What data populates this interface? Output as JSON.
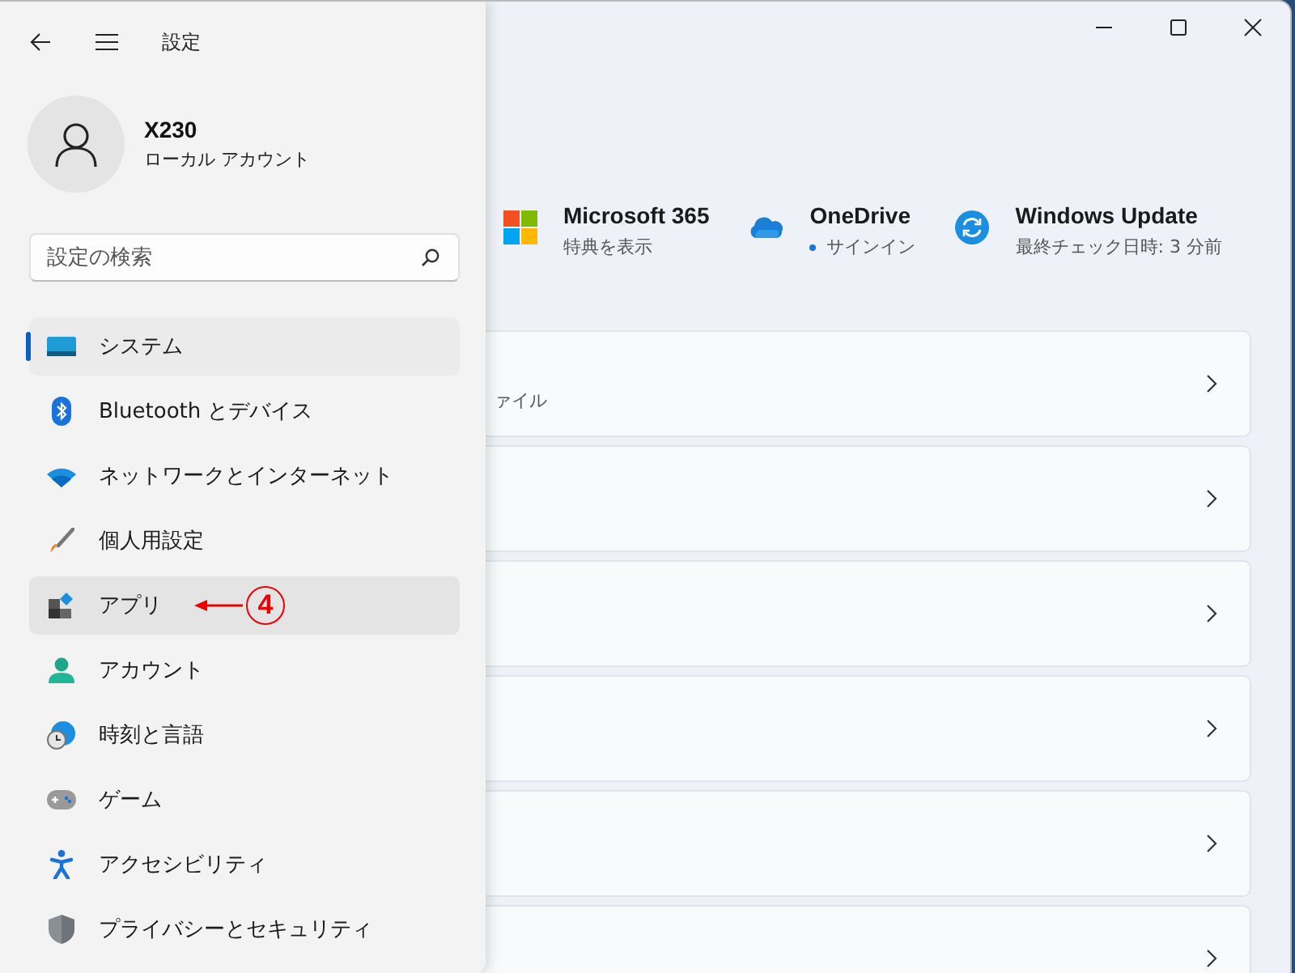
{
  "window": {
    "title": "設定",
    "controls": [
      {
        "kind": "minimize"
      },
      {
        "kind": "maximize"
      },
      {
        "kind": "close"
      }
    ]
  },
  "account": {
    "name": "X230",
    "type": "ローカル アカウント"
  },
  "search": {
    "placeholder": "設定の検索"
  },
  "nav_items": [
    {
      "label": "システム",
      "kind": "system",
      "selected": true,
      "hovered": false
    },
    {
      "label": "Bluetooth とデバイス",
      "kind": "bluetooth",
      "selected": false,
      "hovered": false
    },
    {
      "label": "ネットワークとインターネット",
      "kind": "network",
      "selected": false,
      "hovered": false
    },
    {
      "label": "個人用設定",
      "kind": "brush",
      "selected": false,
      "hovered": false
    },
    {
      "label": "アプリ",
      "kind": "apps",
      "selected": false,
      "hovered": true,
      "annotation": "4"
    },
    {
      "label": "アカウント",
      "kind": "person",
      "selected": false,
      "hovered": false
    },
    {
      "label": "時刻と言語",
      "kind": "globe",
      "selected": false,
      "hovered": false
    },
    {
      "label": "ゲーム",
      "kind": "gamepad",
      "selected": false,
      "hovered": false
    },
    {
      "label": "アクセシビリティ",
      "kind": "accessibility",
      "selected": false,
      "hovered": false
    },
    {
      "label": "プライバシーとセキュリティ",
      "kind": "shield",
      "selected": false,
      "hovered": false
    }
  ],
  "quick_links": [
    {
      "kind": "tiles",
      "title": "Microsoft 365",
      "subtitle": "特典を表示"
    },
    {
      "kind": "cloud",
      "title": "OneDrive",
      "subtitle": "サインイン",
      "dot": true
    },
    {
      "kind": "sync",
      "title": "Windows Update",
      "subtitle": "最終チェック日時: 3 分前"
    }
  ],
  "cards": [
    {
      "kind": "link",
      "subtitle": "ァイル"
    },
    {
      "kind": "link"
    },
    {
      "kind": "link"
    },
    {
      "kind": "link"
    },
    {
      "kind": "link"
    },
    {
      "kind": "link"
    }
  ]
}
